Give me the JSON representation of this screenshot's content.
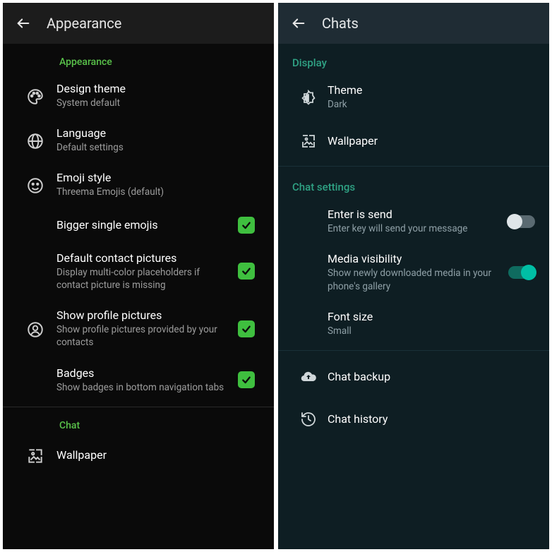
{
  "left": {
    "title": "Appearance",
    "sections": {
      "appearance": {
        "label": "Appearance",
        "design_theme": {
          "title": "Design theme",
          "sub": "System default"
        },
        "language": {
          "title": "Language",
          "sub": "Default settings"
        },
        "emoji_style": {
          "title": "Emoji style",
          "sub": "Threema Emojis (default)"
        },
        "bigger_emojis": {
          "title": "Bigger single emojis",
          "checked": true
        },
        "default_contact": {
          "title": "Default contact pictures",
          "sub": "Display multi-color placeholders if contact picture is missing",
          "checked": true
        },
        "show_profile": {
          "title": "Show profile pictures",
          "sub": "Show profile pictures provided by your contacts",
          "checked": true
        },
        "badges": {
          "title": "Badges",
          "sub": "Show badges in bottom navigation tabs",
          "checked": true
        }
      },
      "chat": {
        "label": "Chat",
        "wallpaper": {
          "title": "Wallpaper"
        }
      }
    }
  },
  "right": {
    "title": "Chats",
    "sections": {
      "display": {
        "label": "Display",
        "theme": {
          "title": "Theme",
          "sub": "Dark"
        },
        "wallpaper": {
          "title": "Wallpaper"
        }
      },
      "chat_settings": {
        "label": "Chat settings",
        "enter_is_send": {
          "title": "Enter is send",
          "sub": "Enter key will send your message",
          "on": false
        },
        "media_vis": {
          "title": "Media visibility",
          "sub": "Show newly downloaded media in your phone's gallery",
          "on": true
        },
        "font_size": {
          "title": "Font size",
          "sub": "Small"
        }
      },
      "other": {
        "chat_backup": {
          "title": "Chat backup"
        },
        "chat_history": {
          "title": "Chat history"
        }
      }
    }
  }
}
